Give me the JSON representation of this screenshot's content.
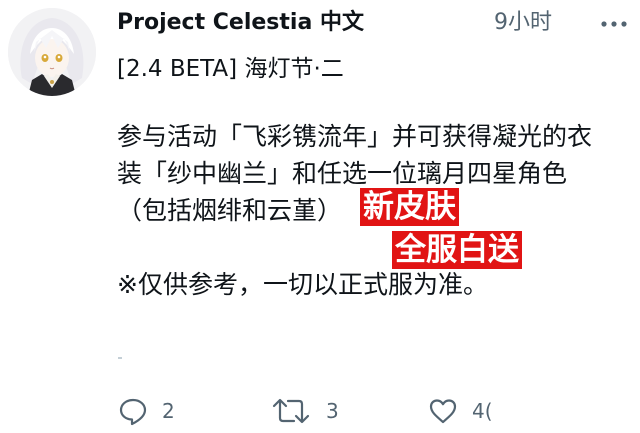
{
  "tweet": {
    "author_name": "Project Celestia 中文",
    "timestamp": "9小时",
    "subtitle": "[2.4 BETA] 海灯节·二",
    "body_lines": [
      "参与活动「飞彩镌流年」并可获得凝光的衣",
      "装「纱中幽兰」和任选一位璃月四星角色",
      "（包括烟绯和云堇）",
      "",
      "※仅供参考，一切以正式服为准。"
    ],
    "overlay_labels": [
      "新皮肤",
      "全服白送"
    ]
  },
  "actions": {
    "reply_count": "2",
    "retweet_count": "3",
    "like_count": "4("
  },
  "colors": {
    "text": "#0f1419",
    "secondary": "#536471",
    "overlay_bg": "#e11414"
  },
  "icons": [
    "avatar",
    "more-icon",
    "reply-icon",
    "retweet-icon",
    "like-icon"
  ]
}
